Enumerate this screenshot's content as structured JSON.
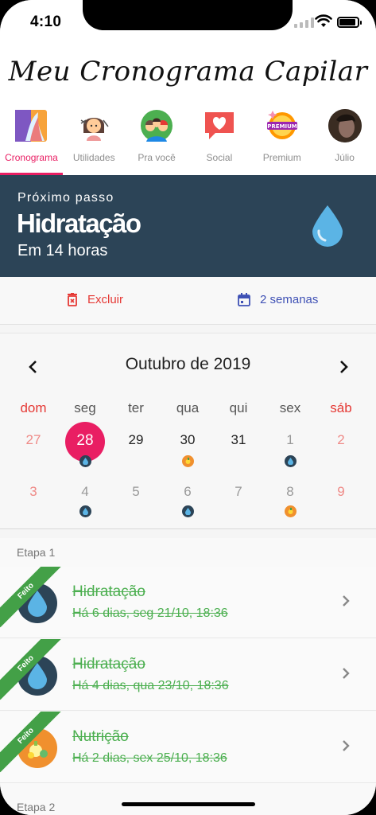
{
  "status": {
    "time": "4:10"
  },
  "header": {
    "title": "Meu Cronograma Capilar"
  },
  "tabs": [
    {
      "label": "Cronograma",
      "icon": "schedule-art-icon",
      "active": true
    },
    {
      "label": "Utilidades",
      "icon": "stylist-icon",
      "active": false
    },
    {
      "label": "Pra você",
      "icon": "people-icon",
      "active": false
    },
    {
      "label": "Social",
      "icon": "heart-chat-icon",
      "active": false
    },
    {
      "label": "Premium",
      "icon": "premium-badge-icon",
      "active": false
    },
    {
      "label": "Júlio",
      "icon": "avatar-icon",
      "active": false
    }
  ],
  "next_step": {
    "label": "Próximo passo",
    "title": "Hidratação",
    "time": "Em 14 horas"
  },
  "actions": {
    "delete": "Excluir",
    "weeks": "2 semanas"
  },
  "calendar": {
    "month": "Outubro de 2019",
    "weekdays": [
      "dom",
      "seg",
      "ter",
      "qua",
      "qui",
      "sex",
      "sáb"
    ],
    "weeks": [
      [
        "27",
        "28",
        "29",
        "30",
        "31",
        "1",
        "2"
      ],
      [
        "3",
        "4",
        "5",
        "6",
        "7",
        "8",
        "9"
      ]
    ]
  },
  "stages": [
    {
      "label": "Etapa 1",
      "items": [
        {
          "title": "Hidratação",
          "subtitle": "Há 6 dias, seg 21/10, 18:36",
          "badge": "Feito"
        },
        {
          "title": "Hidratação",
          "subtitle": "Há 4 dias, qua 23/10, 18:36",
          "badge": "Feito"
        },
        {
          "title": "Nutrição",
          "subtitle": "Há 2 dias, sex 25/10, 18:36",
          "badge": "Feito"
        }
      ]
    },
    {
      "label": "Etapa 2"
    }
  ],
  "colors": {
    "accent": "#e91e63",
    "banner": "#2c4457",
    "done": "#4caf50",
    "danger": "#e53935",
    "link": "#3f51b5"
  }
}
